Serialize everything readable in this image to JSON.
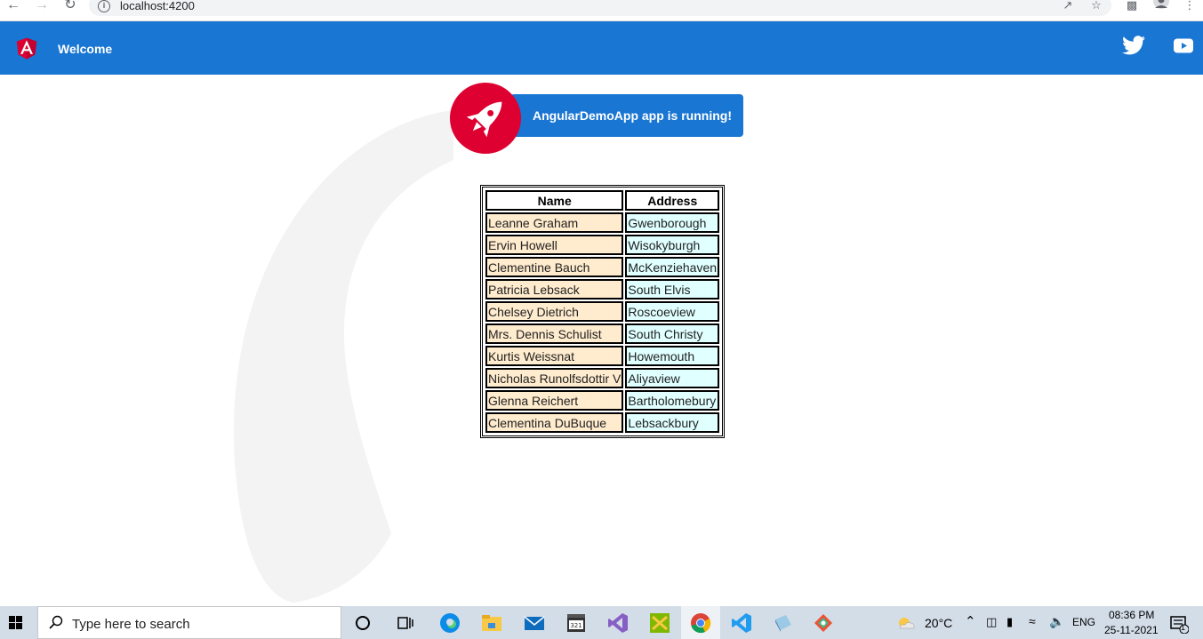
{
  "browser": {
    "url": "localhost:4200"
  },
  "toolbar": {
    "title": "Welcome"
  },
  "card": {
    "message": "AngularDemoApp app is running!"
  },
  "table": {
    "headers": [
      "Name",
      "Address"
    ],
    "rows": [
      {
        "name": "Leanne Graham",
        "address": "Gwenborough"
      },
      {
        "name": "Ervin Howell",
        "address": "Wisokyburgh"
      },
      {
        "name": "Clementine Bauch",
        "address": "McKenziehaven"
      },
      {
        "name": "Patricia Lebsack",
        "address": "South Elvis"
      },
      {
        "name": "Chelsey Dietrich",
        "address": "Roscoeview"
      },
      {
        "name": "Mrs. Dennis Schulist",
        "address": "South Christy"
      },
      {
        "name": "Kurtis Weissnat",
        "address": "Howemouth"
      },
      {
        "name": "Nicholas Runolfsdottir V",
        "address": "Aliyaview"
      },
      {
        "name": "Glenna Reichert",
        "address": "Bartholomebury"
      },
      {
        "name": "Clementina DuBuque",
        "address": "Lebsackbury"
      }
    ]
  },
  "taskbar": {
    "search_placeholder": "Type here to search",
    "temperature": "20°C",
    "language": "ENG",
    "time": "08:36 PM",
    "date": "25-11-2021",
    "notification_count": "1"
  },
  "colors": {
    "toolbar": "#1976d2",
    "angular_red": "#dd0031",
    "name_cell": "#ffebcd",
    "address_cell": "#e0ffff"
  }
}
